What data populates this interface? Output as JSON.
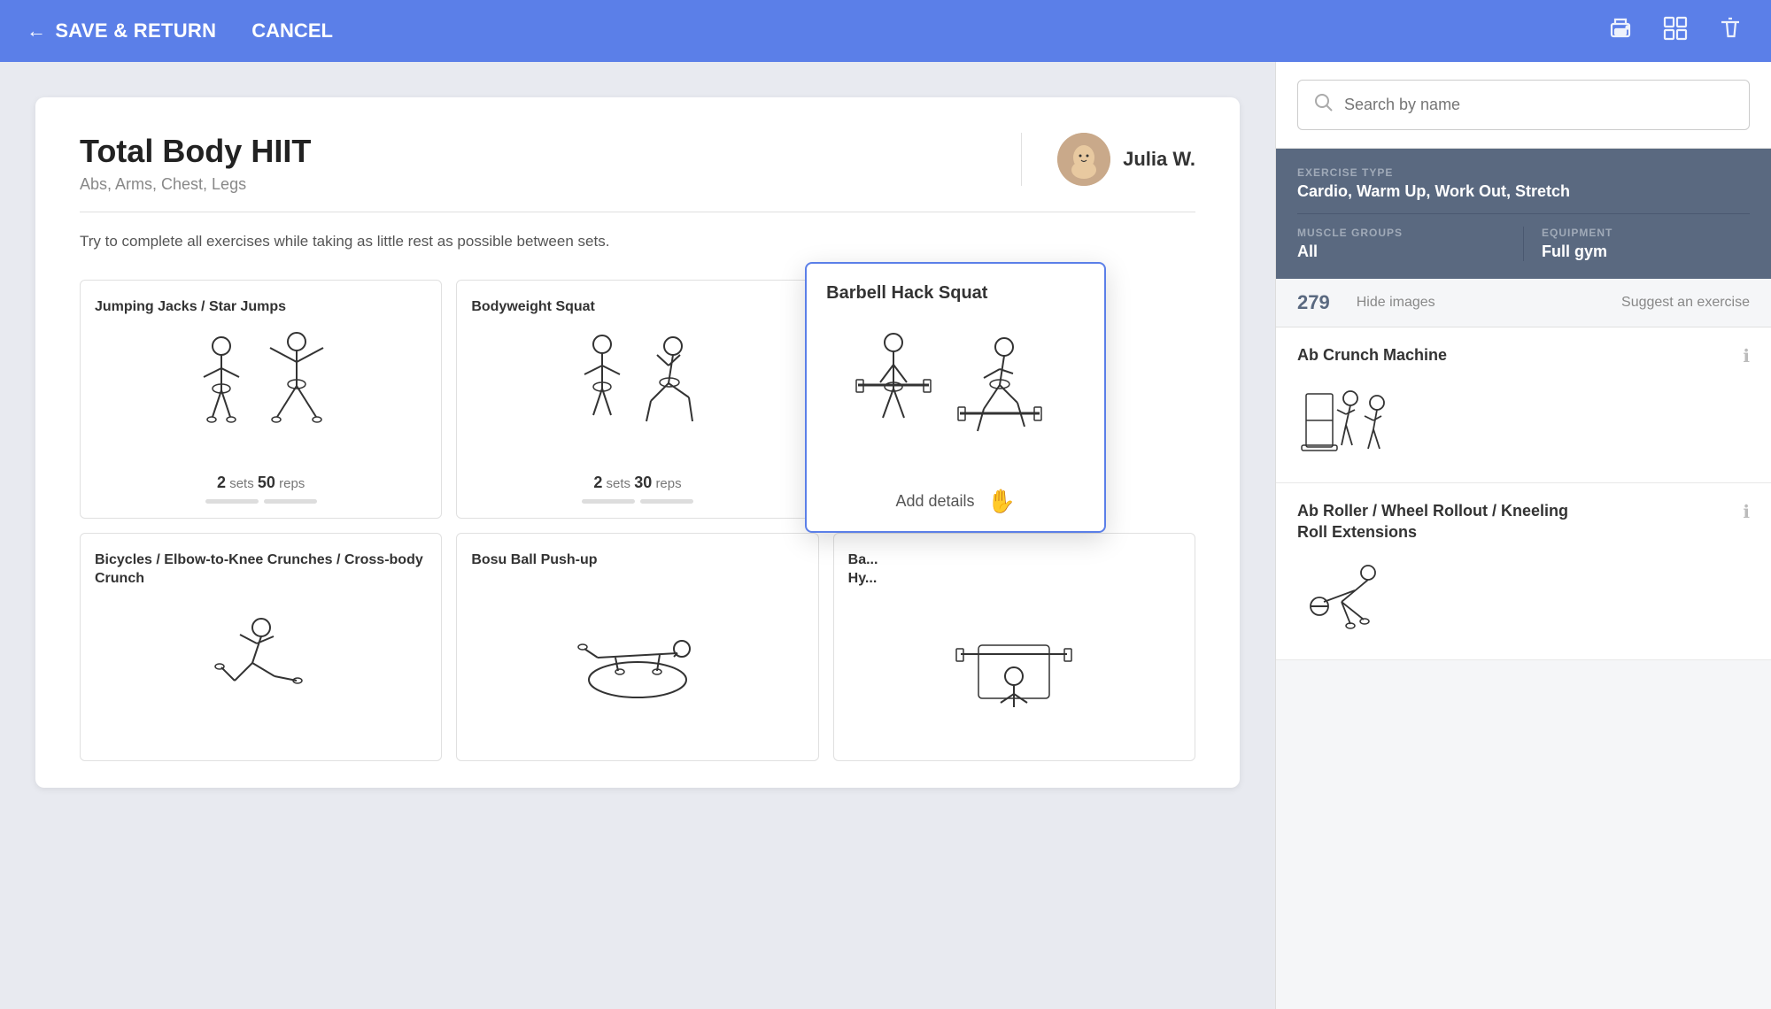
{
  "nav": {
    "save_return_label": "SAVE & RETURN",
    "cancel_label": "CANCEL",
    "icons": [
      "print-icon",
      "grid-icon",
      "trash-icon"
    ]
  },
  "workout": {
    "title": "Total Body HIIT",
    "subtitle": "Abs, Arms, Chest, Legs",
    "description": "Try to complete all exercises while taking as little rest as possible between sets.",
    "trainer_name": "Julia W."
  },
  "exercises": [
    {
      "name": "Jumping Jacks / Star Jumps",
      "sets": 2,
      "reps": 50,
      "unit": "reps"
    },
    {
      "name": "Bodyweight Squat",
      "sets": 2,
      "reps": 30,
      "unit": "reps"
    },
    {
      "name": "Bicycles / Elbow-to-Knee Crunches / Cross-body Crunch",
      "sets": 0,
      "reps": 0,
      "unit": ""
    },
    {
      "name": "Bosu Ball Push-up",
      "sets": 0,
      "reps": 0,
      "unit": ""
    },
    {
      "name": "Ba... Hy...",
      "sets": 0,
      "reps": 0,
      "unit": ""
    }
  ],
  "popup": {
    "title": "Barbell Hack Squat",
    "add_details_label": "Add details"
  },
  "sidebar": {
    "search_placeholder": "Search by name",
    "filters": {
      "exercise_type_label": "EXERCISE TYPE",
      "exercise_type_value": "Cardio, Warm Up, Work Out, Stretch",
      "muscle_groups_label": "MUSCLE GROUPS",
      "muscle_groups_value": "All",
      "equipment_label": "EQUIPMENT",
      "equipment_value": "Full gym"
    },
    "stats": {
      "count": "279",
      "hide_images_label": "Hide images",
      "suggest_label": "Suggest an exercise"
    },
    "exercise_list": [
      {
        "name": "Ab Crunch Machine"
      },
      {
        "name": "Ab Roller / Wheel Rollout / Kneeling Roll Extensions"
      }
    ]
  }
}
